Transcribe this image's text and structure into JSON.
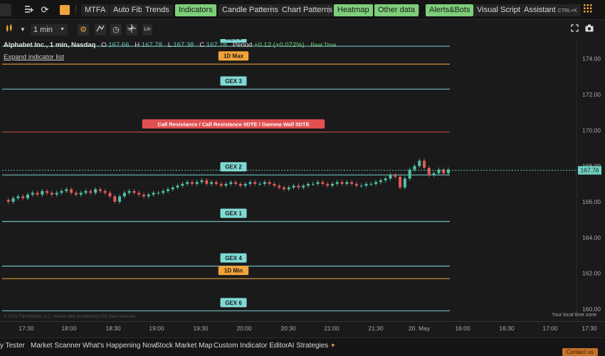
{
  "topbar": {
    "buttons": [
      {
        "id": "mtfa",
        "label": "MTFA"
      },
      {
        "id": "autofib",
        "label": "Auto Fib"
      },
      {
        "id": "trends",
        "label": "Trends"
      },
      {
        "id": "indicators",
        "label": "Indicators"
      },
      {
        "id": "candle",
        "label": "Candle Patterns"
      },
      {
        "id": "chartpatterns",
        "label": "Chart Patterns"
      },
      {
        "id": "heatmap",
        "label": "Heatmap"
      },
      {
        "id": "otherdata",
        "label": "Other data"
      },
      {
        "id": "alerts",
        "label": "Alerts&Bots"
      },
      {
        "id": "visual",
        "label": "Visual Scripts"
      },
      {
        "id": "assistant",
        "label": "Assistant"
      }
    ],
    "assistant_shortcut": "CTRL+K",
    "colors": {
      "green_button": "#7ecf7a",
      "accent_orange": "#f2a33a"
    }
  },
  "toolbar2": {
    "timeframe": "1 min",
    "scale_label": "Lin"
  },
  "legend": {
    "name": "Alphabet Inc., 1 min, Nasdaq",
    "o_label": "O",
    "o_value": "167.66",
    "h_label": "H",
    "h_value": "167.78",
    "l_label": "L",
    "l_value": "167.38",
    "c_label": "C",
    "c_value": "167.78",
    "period_label": "Period",
    "period_value": "+0.12 (+0.072%)",
    "realtime": "Real Time"
  },
  "expand_text": "Expand indicator list",
  "copyright": "© 2025 TrendSpider LLC. Market data provided by ICE Data Services.",
  "local_tz": "Your local time zone",
  "chart_data": {
    "type": "line",
    "ylim": [
      159.4,
      175.1
    ],
    "y_ticks": [
      "174.00",
      "172.00",
      "170.00",
      "168.00",
      "166.00",
      "164.00",
      "162.00",
      "160.00"
    ],
    "x_ticks": [
      "17:30",
      "18:00",
      "18:30",
      "19:00",
      "19:30",
      "20:00",
      "20:30",
      "21:00",
      "21:30",
      "20. May",
      "16:00",
      "16:30",
      "17:00",
      "17:30"
    ],
    "last_price": "167.76",
    "levels": [
      {
        "label": "GEX 5",
        "price": 174.7,
        "color": "#7fd9d4"
      },
      {
        "label": "1D Max",
        "price": 173.7,
        "color": "#f2a33a"
      },
      {
        "label": "GEX 3",
        "price": 172.3,
        "color": "#7fd9d4"
      },
      {
        "label": "Call Resistance / Call Resistance 0DTE / Gamma Wall 0DTE",
        "price": 169.9,
        "color": "#e05050"
      },
      {
        "label": "GEX 2",
        "price": 167.5,
        "color": "#7fd9d4"
      },
      {
        "label": "GEX 1",
        "price": 164.9,
        "color": "#7fd9d4"
      },
      {
        "label": "GEX 4",
        "price": 162.4,
        "color": "#7fd9d4"
      },
      {
        "label": "1D Min",
        "price": 161.7,
        "color": "#f2a33a"
      },
      {
        "label": "GEX 6",
        "price": 159.9,
        "color": "#7fd9d4"
      }
    ],
    "price_series": [
      166.1,
      166.0,
      166.2,
      166.3,
      166.2,
      166.4,
      166.5,
      166.4,
      166.6,
      166.5,
      166.4,
      166.5,
      166.6,
      166.7,
      166.5,
      166.4,
      166.5,
      166.6,
      166.5,
      166.7,
      166.6,
      166.5,
      166.3,
      166.0,
      166.3,
      166.5,
      166.6,
      166.5,
      166.4,
      166.3,
      166.4,
      166.5,
      166.5,
      166.6,
      166.7,
      166.8,
      166.9,
      167.0,
      167.1,
      167.0,
      167.1,
      167.2,
      167.0,
      167.1,
      167.0,
      166.9,
      167.0,
      167.1,
      167.0,
      166.9,
      167.0,
      167.1,
      167.0,
      167.0,
      167.1,
      167.0,
      166.9,
      166.8,
      166.7,
      166.8,
      166.9,
      166.8,
      166.9,
      167.0,
      167.0,
      167.1,
      167.0,
      166.9,
      167.0,
      167.1,
      167.0,
      167.1,
      167.0,
      166.9,
      166.9,
      167.0,
      167.0,
      167.1,
      167.2,
      167.3,
      167.5,
      167.4,
      166.8,
      167.3,
      167.8,
      168.0,
      168.3,
      167.9,
      167.5,
      167.6,
      167.8,
      167.6,
      167.8
    ]
  },
  "bottombar": {
    "items": [
      "y Tester",
      "Market Scanner",
      "What's Happening Now",
      "Stock Market Map",
      "Custom Indicator Editor",
      "AI Strategies"
    ],
    "contact": "Contact us"
  }
}
